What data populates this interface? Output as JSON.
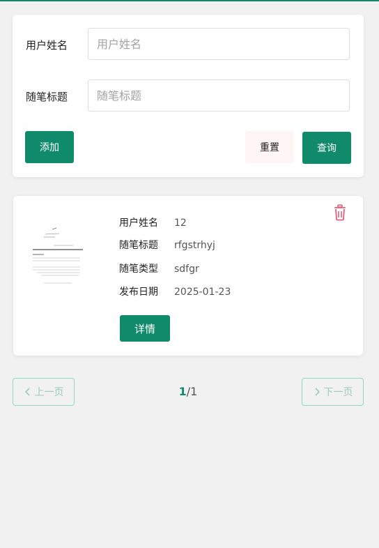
{
  "search": {
    "username_label": "用户姓名",
    "username_placeholder": "用户姓名",
    "username_value": "",
    "title_label": "随笔标题",
    "title_placeholder": "随笔标题",
    "title_value": "",
    "add_label": "添加",
    "reset_label": "重置",
    "query_label": "查询"
  },
  "items": [
    {
      "thumbnail_icon": "document-thumbnail",
      "fields": [
        {
          "label": "用户姓名",
          "value": "12"
        },
        {
          "label": "随笔标题",
          "value": "rfgstrhyj"
        },
        {
          "label": "随笔类型",
          "value": "sdfgr"
        },
        {
          "label": "发布日期",
          "value": "2025-01-23"
        }
      ],
      "detail_label": "详情",
      "delete_icon": "trash-icon"
    }
  ],
  "pagination": {
    "prev_label": "上一页",
    "next_label": "下一页",
    "current": "1",
    "separator": "/",
    "total": "1"
  },
  "colors": {
    "primary": "#0f8a6a",
    "delete": "#e0607a",
    "pager_border": "#8fd6c3",
    "background": "#f1f1f1"
  }
}
